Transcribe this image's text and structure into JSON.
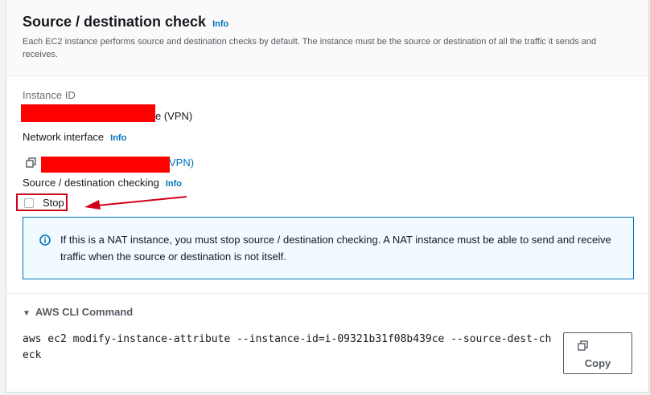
{
  "section": {
    "title": "Source / destination check",
    "info_label": "Info",
    "description": "Each EC2 instance performs source and destination checks by default. The instance must be the source or destination of all the traffic it sends and receives."
  },
  "instance": {
    "label": "Instance ID",
    "value_suffix": "e (VPN)"
  },
  "network_interface": {
    "label": "Network interface",
    "info_label": "Info",
    "value_suffix": "VPN)"
  },
  "checking": {
    "label": "Source / destination checking",
    "info_label": "Info",
    "stop_label": "Stop",
    "stop_checked": false
  },
  "alert": {
    "text": "If this is a NAT instance, you must stop source / destination checking. A NAT instance must be able to send and receive traffic when the source or destination is not itself."
  },
  "cli": {
    "title": "AWS CLI Command",
    "command": "aws ec2 modify-instance-attribute --instance-id=i-09321b31f08b439ce --source-dest-check",
    "copy_label": "Copy"
  },
  "colors": {
    "link": "#0073bb",
    "annotation": "#d0021b",
    "redaction": "#ff0000"
  }
}
